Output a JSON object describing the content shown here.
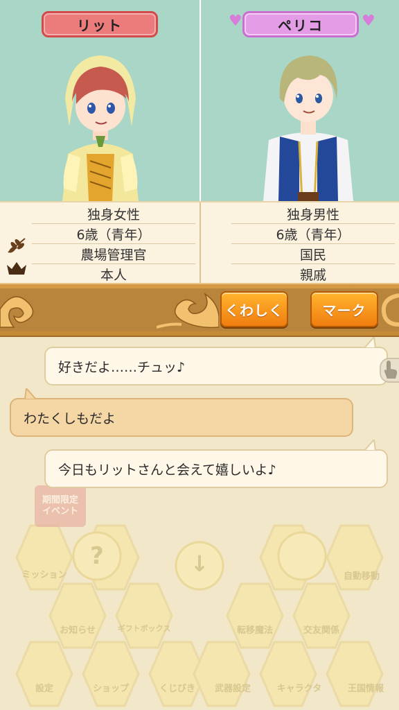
{
  "left_character": {
    "name": "リット",
    "profile": [
      "独身女性",
      "6歳（青年）",
      "農場管理官",
      "本人"
    ]
  },
  "right_character": {
    "name": "ペリコ",
    "profile": [
      "独身男性",
      "6歳（青年）",
      "国民",
      "親戚"
    ]
  },
  "icons": {
    "left_profile_icon_1": "wheat-icon",
    "left_profile_icon_2": "crown-icon",
    "touch_icon": "hand-pointer-icon"
  },
  "buttons": {
    "details": "くわしく",
    "mark": "マーク"
  },
  "chat": [
    {
      "speaker": "right",
      "text": "好きだよ……チュッ♪"
    },
    {
      "speaker": "left",
      "text": "わたくしもだよ"
    },
    {
      "speaker": "right",
      "text": "今日もリットさんと会えて嬉しいよ♪"
    }
  ],
  "background_menu": {
    "event_badge": [
      "期間限定",
      "イベント"
    ],
    "items": [
      "ミッション",
      "?",
      "↓",
      "",
      "自動移動",
      "お知らせ",
      "ギフトボックス",
      "転移魔法",
      "交友関係",
      "設定",
      "ショップ",
      "くじびき",
      "武器設定",
      "キャラクタ",
      "王国情報"
    ]
  },
  "colors": {
    "portrait_bg": "#a9d6c6",
    "left_plate": "#ec7b7b",
    "right_plate": "#e49ce6",
    "button_orange": "#f59a1e",
    "bar_brown": "#c58a36"
  }
}
